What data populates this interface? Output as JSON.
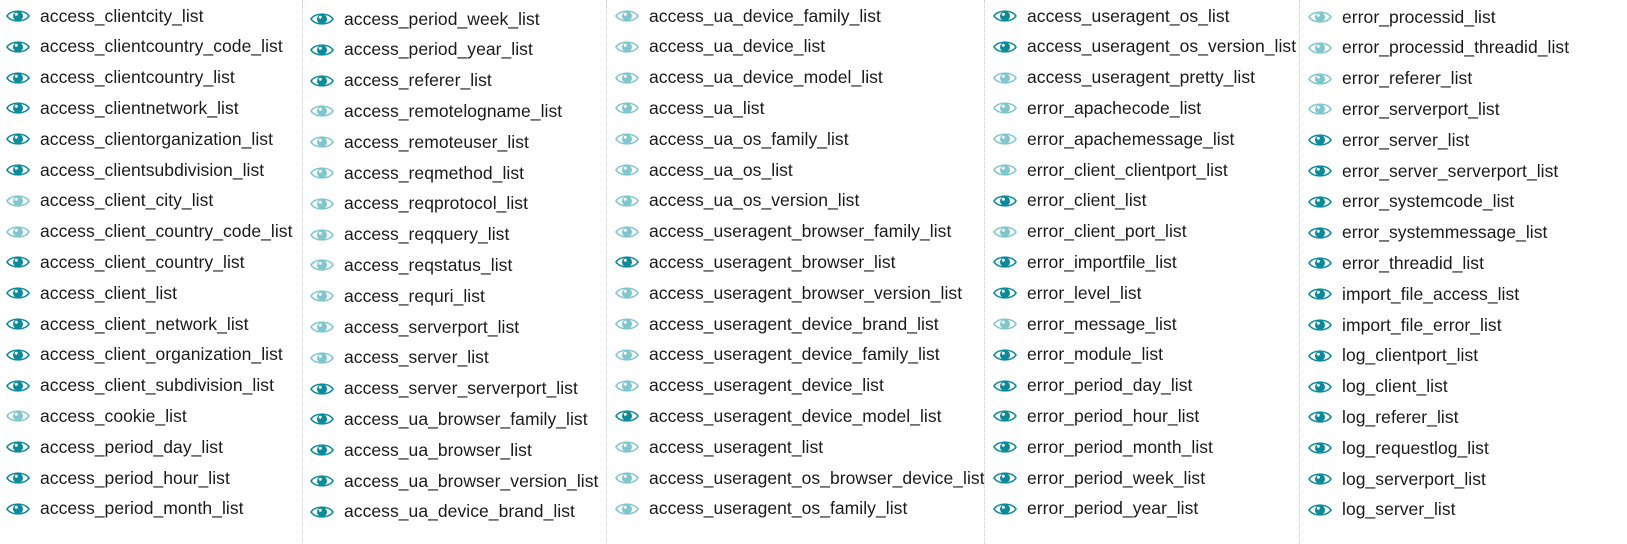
{
  "colors": {
    "eye_visible": "#0a8a9a",
    "eye_faded": "#7fc6cf",
    "text": "#1a1a1a"
  },
  "icon_semantic": "eye-icon",
  "columns": [
    {
      "items": [
        {
          "label": "access_clientcity_list",
          "state": "visible"
        },
        {
          "label": "access_clientcountry_code_list",
          "state": "visible"
        },
        {
          "label": "access_clientcountry_list",
          "state": "visible"
        },
        {
          "label": "access_clientnetwork_list",
          "state": "visible"
        },
        {
          "label": "access_clientorganization_list",
          "state": "visible"
        },
        {
          "label": "access_clientsubdivision_list",
          "state": "visible"
        },
        {
          "label": "access_client_city_list",
          "state": "faded"
        },
        {
          "label": "access_client_country_code_list",
          "state": "faded"
        },
        {
          "label": "access_client_country_list",
          "state": "visible"
        },
        {
          "label": "access_client_list",
          "state": "visible"
        },
        {
          "label": "access_client_network_list",
          "state": "visible"
        },
        {
          "label": "access_client_organization_list",
          "state": "visible"
        },
        {
          "label": "access_client_subdivision_list",
          "state": "visible"
        },
        {
          "label": "access_cookie_list",
          "state": "faded"
        },
        {
          "label": "access_period_day_list",
          "state": "visible"
        },
        {
          "label": "access_period_hour_list",
          "state": "visible"
        },
        {
          "label": "access_period_month_list",
          "state": "visible"
        }
      ]
    },
    {
      "items": [
        {
          "label": "access_period_week_list",
          "state": "visible"
        },
        {
          "label": "access_period_year_list",
          "state": "visible"
        },
        {
          "label": "access_referer_list",
          "state": "visible"
        },
        {
          "label": "access_remotelogname_list",
          "state": "faded"
        },
        {
          "label": "access_remoteuser_list",
          "state": "faded"
        },
        {
          "label": "access_reqmethod_list",
          "state": "faded"
        },
        {
          "label": "access_reqprotocol_list",
          "state": "faded"
        },
        {
          "label": "access_reqquery_list",
          "state": "faded"
        },
        {
          "label": "access_reqstatus_list",
          "state": "faded"
        },
        {
          "label": "access_requri_list",
          "state": "faded"
        },
        {
          "label": "access_serverport_list",
          "state": "faded"
        },
        {
          "label": "access_server_list",
          "state": "faded"
        },
        {
          "label": "access_server_serverport_list",
          "state": "visible"
        },
        {
          "label": "access_ua_browser_family_list",
          "state": "visible"
        },
        {
          "label": "access_ua_browser_list",
          "state": "visible"
        },
        {
          "label": "access_ua_browser_version_list",
          "state": "visible"
        },
        {
          "label": "access_ua_device_brand_list",
          "state": "visible"
        }
      ]
    },
    {
      "items": [
        {
          "label": "access_ua_device_family_list",
          "state": "faded"
        },
        {
          "label": "access_ua_device_list",
          "state": "faded"
        },
        {
          "label": "access_ua_device_model_list",
          "state": "faded"
        },
        {
          "label": "access_ua_list",
          "state": "faded"
        },
        {
          "label": "access_ua_os_family_list",
          "state": "faded"
        },
        {
          "label": "access_ua_os_list",
          "state": "faded"
        },
        {
          "label": "access_ua_os_version_list",
          "state": "faded"
        },
        {
          "label": "access_useragent_browser_family_list",
          "state": "faded"
        },
        {
          "label": "access_useragent_browser_list",
          "state": "visible"
        },
        {
          "label": "access_useragent_browser_version_list",
          "state": "faded"
        },
        {
          "label": "access_useragent_device_brand_list",
          "state": "faded"
        },
        {
          "label": "access_useragent_device_family_list",
          "state": "faded"
        },
        {
          "label": "access_useragent_device_list",
          "state": "faded"
        },
        {
          "label": "access_useragent_device_model_list",
          "state": "visible"
        },
        {
          "label": "access_useragent_list",
          "state": "faded"
        },
        {
          "label": "access_useragent_os_browser_device_list",
          "state": "faded"
        },
        {
          "label": "access_useragent_os_family_list",
          "state": "faded"
        }
      ]
    },
    {
      "items": [
        {
          "label": "access_useragent_os_list",
          "state": "visible"
        },
        {
          "label": "access_useragent_os_version_list",
          "state": "visible"
        },
        {
          "label": "access_useragent_pretty_list",
          "state": "faded"
        },
        {
          "label": "error_apachecode_list",
          "state": "faded"
        },
        {
          "label": "error_apachemessage_list",
          "state": "faded"
        },
        {
          "label": "error_client_clientport_list",
          "state": "faded"
        },
        {
          "label": "error_client_list",
          "state": "visible"
        },
        {
          "label": "error_client_port_list",
          "state": "faded"
        },
        {
          "label": "error_importfile_list",
          "state": "visible"
        },
        {
          "label": "error_level_list",
          "state": "visible"
        },
        {
          "label": "error_message_list",
          "state": "faded"
        },
        {
          "label": "error_module_list",
          "state": "visible"
        },
        {
          "label": "error_period_day_list",
          "state": "visible"
        },
        {
          "label": "error_period_hour_list",
          "state": "visible"
        },
        {
          "label": "error_period_month_list",
          "state": "visible"
        },
        {
          "label": "error_period_week_list",
          "state": "visible"
        },
        {
          "label": "error_period_year_list",
          "state": "visible"
        }
      ]
    },
    {
      "items": [
        {
          "label": "error_processid_list",
          "state": "faded"
        },
        {
          "label": "error_processid_threadid_list",
          "state": "faded"
        },
        {
          "label": "error_referer_list",
          "state": "faded"
        },
        {
          "label": "error_serverport_list",
          "state": "faded"
        },
        {
          "label": "error_server_list",
          "state": "visible"
        },
        {
          "label": "error_server_serverport_list",
          "state": "visible"
        },
        {
          "label": "error_systemcode_list",
          "state": "visible"
        },
        {
          "label": "error_systemmessage_list",
          "state": "visible"
        },
        {
          "label": "error_threadid_list",
          "state": "visible"
        },
        {
          "label": "import_file_access_list",
          "state": "visible"
        },
        {
          "label": "import_file_error_list",
          "state": "visible"
        },
        {
          "label": "log_clientport_list",
          "state": "visible"
        },
        {
          "label": "log_client_list",
          "state": "visible"
        },
        {
          "label": "log_referer_list",
          "state": "visible"
        },
        {
          "label": "log_requestlog_list",
          "state": "visible"
        },
        {
          "label": "log_serverport_list",
          "state": "visible"
        },
        {
          "label": "log_server_list",
          "state": "visible"
        }
      ]
    }
  ]
}
